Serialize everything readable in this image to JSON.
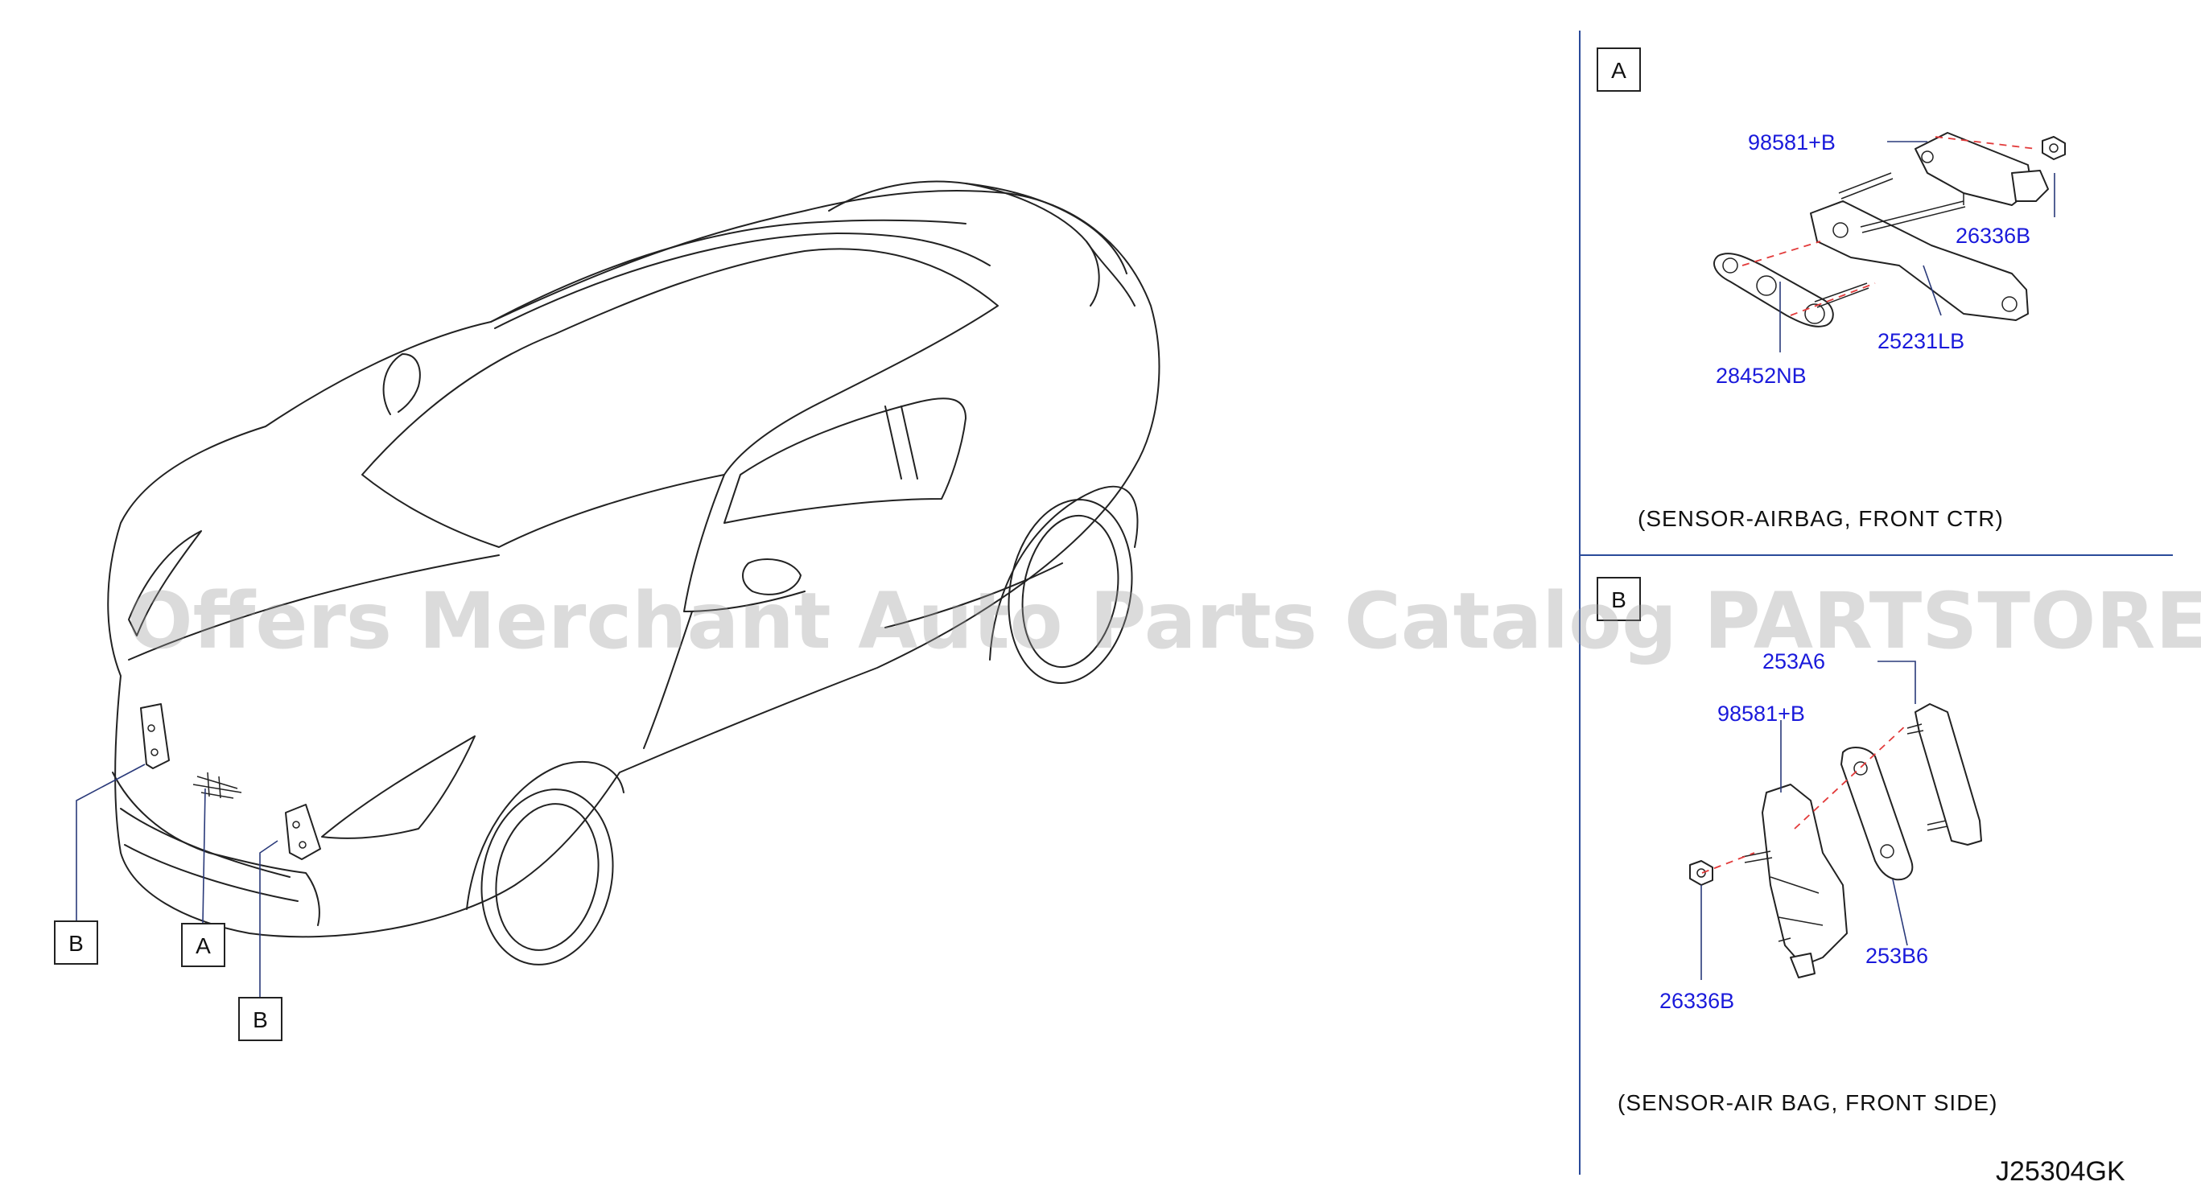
{
  "panel_a": {
    "letter": "A",
    "caption": "(SENSOR-AIRBAG,   FRONT   CTR)",
    "labels": [
      "98581+B",
      "26336B",
      "25231LB",
      "28452NB"
    ]
  },
  "panel_b": {
    "letter": "B",
    "caption": "(SENSOR-AIR   BAG,   FRONT   SIDE)",
    "labels": [
      "253A6",
      "98581+B",
      "253B6",
      "26336B"
    ]
  },
  "car_callouts": [
    "B",
    "A",
    "B"
  ],
  "watermark": "Offers Merchant Auto Parts Catalog PARTSTORE.SA",
  "diagram_code": "J25304GK"
}
